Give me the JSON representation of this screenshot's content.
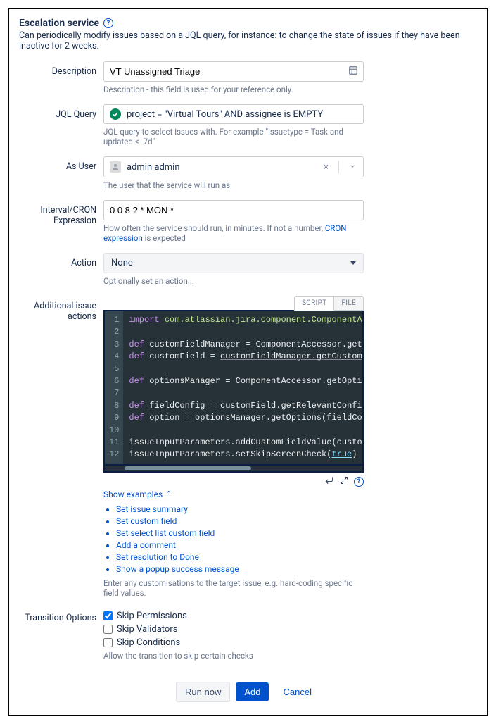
{
  "header": {
    "title": "Escalation service",
    "subtitle": "Can periodically modify issues based on a JQL query, for instance: to change the state of issues if they have been inactive for 2 weeks."
  },
  "fields": {
    "description": {
      "label": "Description",
      "value": "VT Unassigned Triage",
      "helper": "Description - this field is used for your reference only."
    },
    "jql": {
      "label": "JQL Query",
      "value": "project = \"Virtual Tours\" AND assignee is EMPTY",
      "helper": "JQL query to select issues with. For example \"issuetype = Task and updated < -7d\""
    },
    "user": {
      "label": "As User",
      "value": "admin admin",
      "helper": "The user that the service will run as"
    },
    "interval": {
      "label": "Interval/CRON Expression",
      "value": "0 0 8 ? * MON *",
      "helper_before": "How often the service should run, in minutes. If not a number, ",
      "helper_link": "CRON expression",
      "helper_after": " is expected"
    },
    "action": {
      "label": "Action",
      "value": "None",
      "helper": "Optionally set an action..."
    },
    "additional": {
      "label": "Additional issue actions",
      "tabs": {
        "script": "SCRIPT",
        "file": "FILE"
      },
      "show_examples": "Show examples",
      "examples": [
        "Set issue summary",
        "Set custom field",
        "Set select list custom field",
        "Add a comment",
        "Set resolution to Done",
        "Show a popup success message"
      ],
      "helper": "Enter any customisations to the target issue, e.g. hard-coding specific field values."
    },
    "transition": {
      "label": "Transition Options",
      "options": [
        {
          "label": "Skip Permissions",
          "checked": true
        },
        {
          "label": "Skip Validators",
          "checked": false
        },
        {
          "label": "Skip Conditions",
          "checked": false
        }
      ],
      "helper": "Allow the transition to skip certain checks"
    }
  },
  "code": {
    "lines": [
      "import com.atlassian.jira.component.ComponentAccesso",
      "",
      "def customFieldManager = ComponentAccessor.getCustom",
      "def customField = customFieldManager.getCustomFieldO",
      "",
      "def optionsManager = ComponentAccessor.getOptionsMan",
      "",
      "def fieldConfig = customField.getRelevantConfig(issu",
      "def option = optionsManager.getOptions(fieldConfig).",
      "",
      "issueInputParameters.addCustomFieldValue(customField",
      "issueInputParameters.setSkipScreenCheck(true)"
    ]
  },
  "footer": {
    "run_now": "Run now",
    "add": "Add",
    "cancel": "Cancel"
  }
}
